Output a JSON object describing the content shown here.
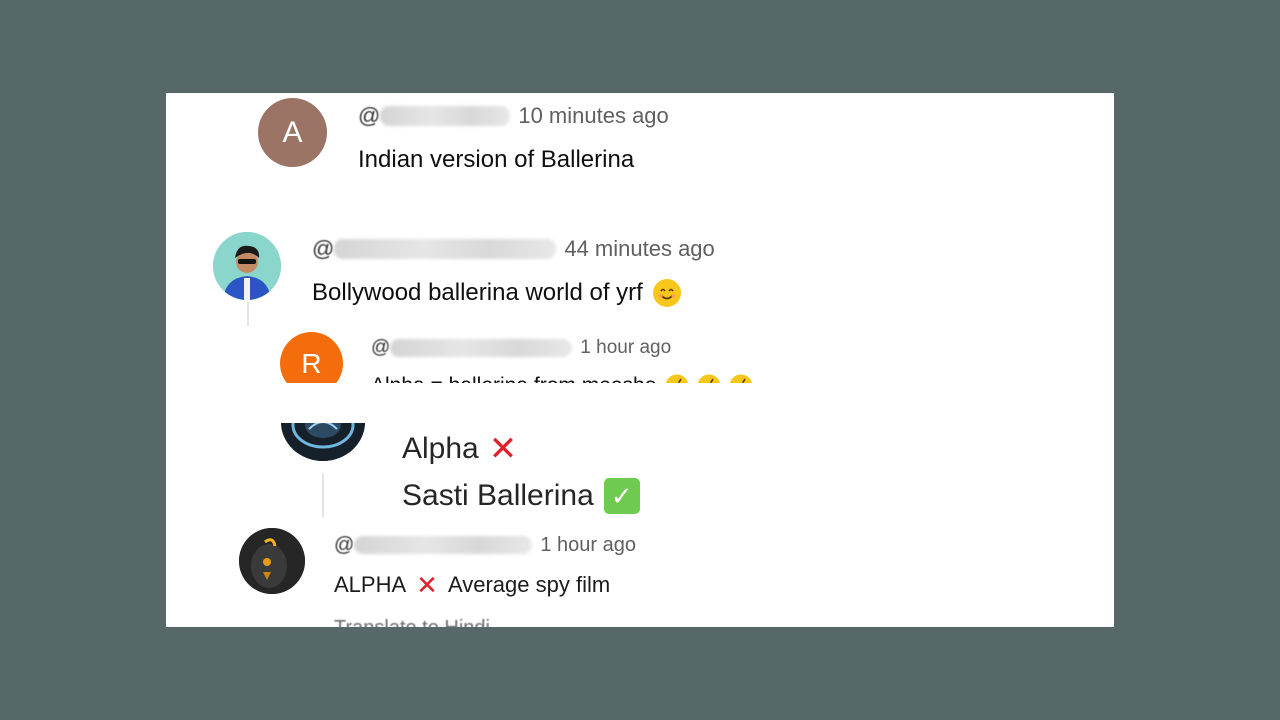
{
  "comments": [
    {
      "avatar_letter": "A",
      "avatar_color": "#9c7466",
      "time": "10 minutes ago",
      "text": "Indian version of Ballerina"
    },
    {
      "avatar_color": "#7fd2c8",
      "time": "44 minutes ago",
      "text": "Bollywood ballerina world of yrf",
      "emoji": "smiling-face"
    },
    {
      "avatar_letter": "R",
      "avatar_color": "#f46d0c",
      "time": "1 hour ago",
      "text": "Alpha = ballerina from meesho",
      "emoji": "rolling-laughing-face"
    },
    {
      "avatar_color": "#1d2a36",
      "line1": "Alpha",
      "line2": "Sasti Ballerina"
    },
    {
      "avatar_color": "#2b2b2b",
      "time": "1 hour ago",
      "text_a": "ALPHA",
      "text_b": "Average spy film",
      "translate": "Translate to Hindi"
    }
  ],
  "colors": {
    "backdrop": "#566867",
    "panel": "#ffffff",
    "cross": "#e0202b",
    "check": "#6ecb4f"
  }
}
